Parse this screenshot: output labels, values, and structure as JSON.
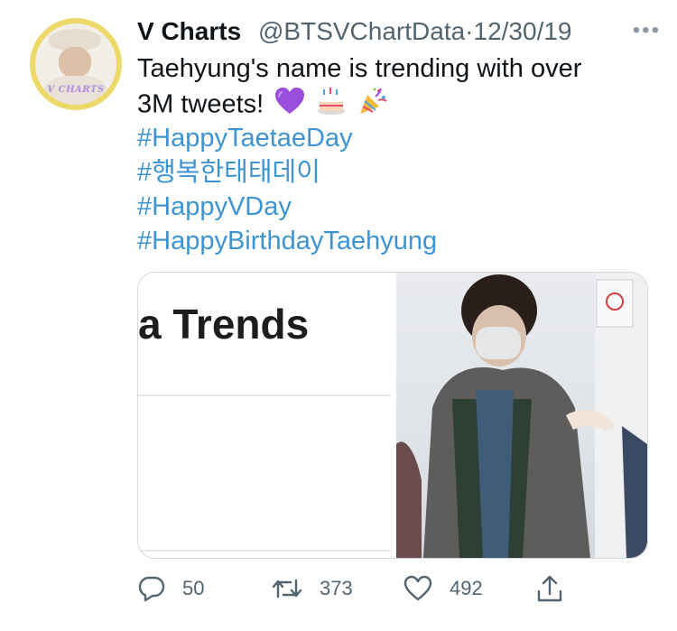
{
  "author": {
    "name": "V Charts",
    "handle": "@BTSVChartData",
    "separator": "·",
    "date": "12/30/19",
    "avatar_logo_text": "V CHARTS"
  },
  "tweet": {
    "line1": "Taehyung's name is trending with over",
    "line2": "3M tweets!",
    "emojis": [
      "purple-heart-icon",
      "birthday-cake-icon",
      "party-popper-icon"
    ],
    "hashtags": [
      "#HappyTaetaeDay",
      "#행복한태태데이",
      "#HappyVDay",
      "#HappyBirthdayTaehyung"
    ]
  },
  "media": {
    "left_text": "a Trends"
  },
  "actions": {
    "reply_count": "50",
    "retweet_count": "373",
    "like_count": "492"
  },
  "colors": {
    "hashtag": "#3e94d1",
    "muted": "#536471",
    "avatar_ring": "#ecd96a"
  }
}
